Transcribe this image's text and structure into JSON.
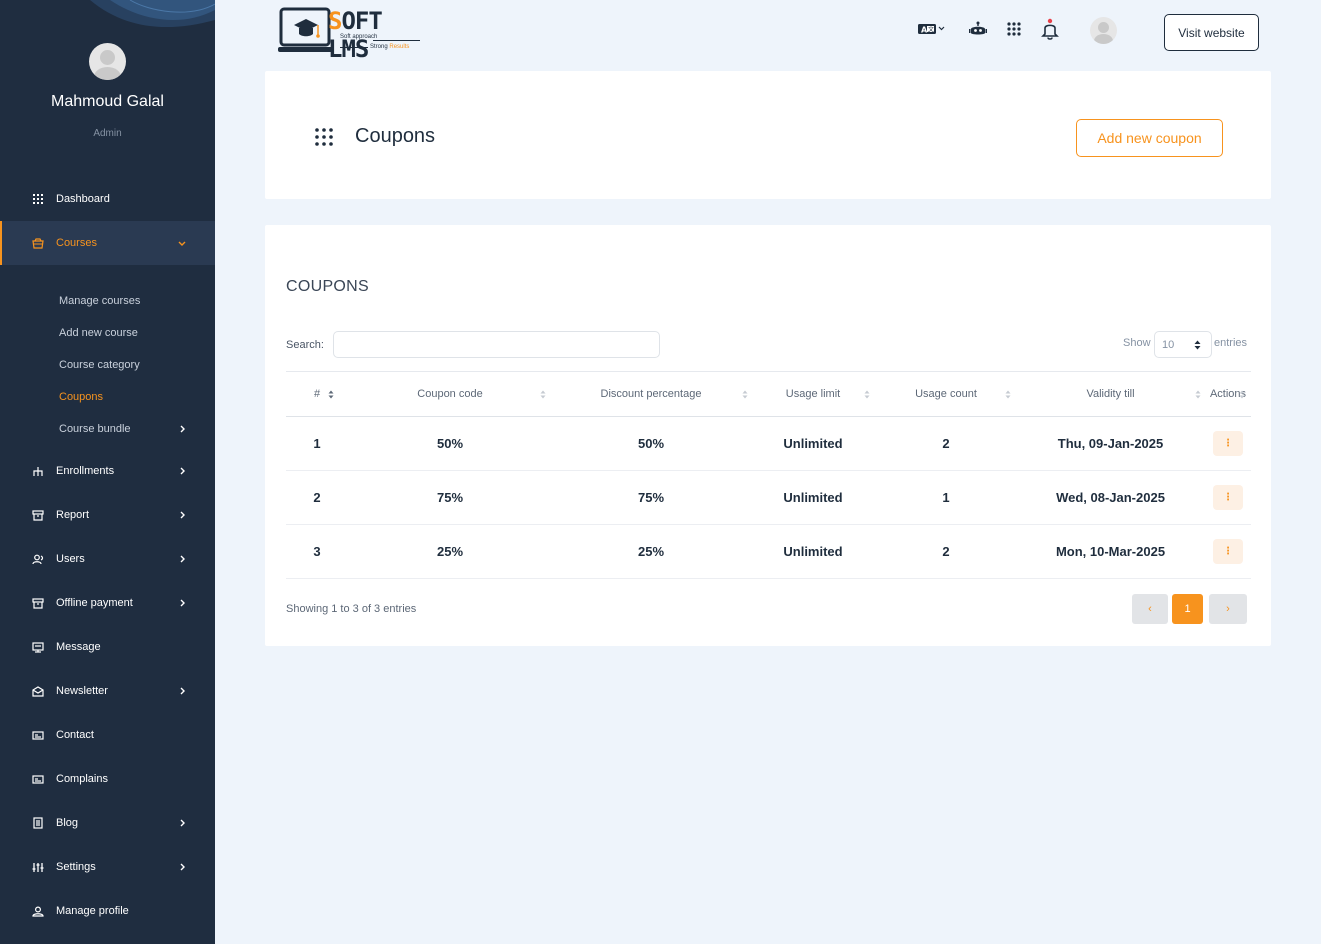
{
  "colors": {
    "sidebar": "#1f2d40",
    "accent": "#f7931e",
    "page_bg": "#eef4fb"
  },
  "profile": {
    "name": "Mahmoud Galal",
    "role": "Admin"
  },
  "logo": {
    "title_s": "S",
    "title_rest": "OFT LMS",
    "tagline1": "Soft approach",
    "tagline2": "Strong",
    "tagline3": "Results"
  },
  "menu": {
    "dashboard": "Dashboard",
    "courses": "Courses",
    "courses_sub": {
      "manage": "Manage courses",
      "add": "Add new course",
      "category": "Course category",
      "coupons": "Coupons",
      "bundle": "Course bundle"
    },
    "enrollments": "Enrollments",
    "report": "Report",
    "users": "Users",
    "offline_payment": "Offline payment",
    "message": "Message",
    "newsletter": "Newsletter",
    "contact": "Contact",
    "complains": "Complains",
    "blog": "Blog",
    "settings": "Settings",
    "manage_profile": "Manage profile"
  },
  "topbar": {
    "visit_website": "Visit website",
    "icons": [
      "language-icon",
      "robot-icon",
      "apps-grid-icon",
      "bell-icon"
    ]
  },
  "header": {
    "title": "Coupons",
    "add_button": "Add new coupon"
  },
  "table_section": {
    "title": "COUPONS",
    "search_label": "Search:",
    "search_value": "",
    "show_label": "Show",
    "show_value": "10",
    "entries_label": "entries",
    "columns": [
      "#",
      "Coupon code",
      "Discount percentage",
      "Usage limit",
      "Usage count",
      "Validity till",
      "Actions"
    ],
    "rows": [
      {
        "num": "1",
        "code": "50%",
        "discount": "50%",
        "limit": "Unlimited",
        "count": "2",
        "validity": "Thu, 09-Jan-2025"
      },
      {
        "num": "2",
        "code": "75%",
        "discount": "75%",
        "limit": "Unlimited",
        "count": "1",
        "validity": "Wed, 08-Jan-2025"
      },
      {
        "num": "3",
        "code": "25%",
        "discount": "25%",
        "limit": "Unlimited",
        "count": "2",
        "validity": "Mon, 10-Mar-2025"
      }
    ],
    "info": "Showing 1 to 3 of 3 entries",
    "pager": {
      "prev": "‹",
      "current": "1",
      "next": "›"
    },
    "action_glyph": "⋮"
  }
}
